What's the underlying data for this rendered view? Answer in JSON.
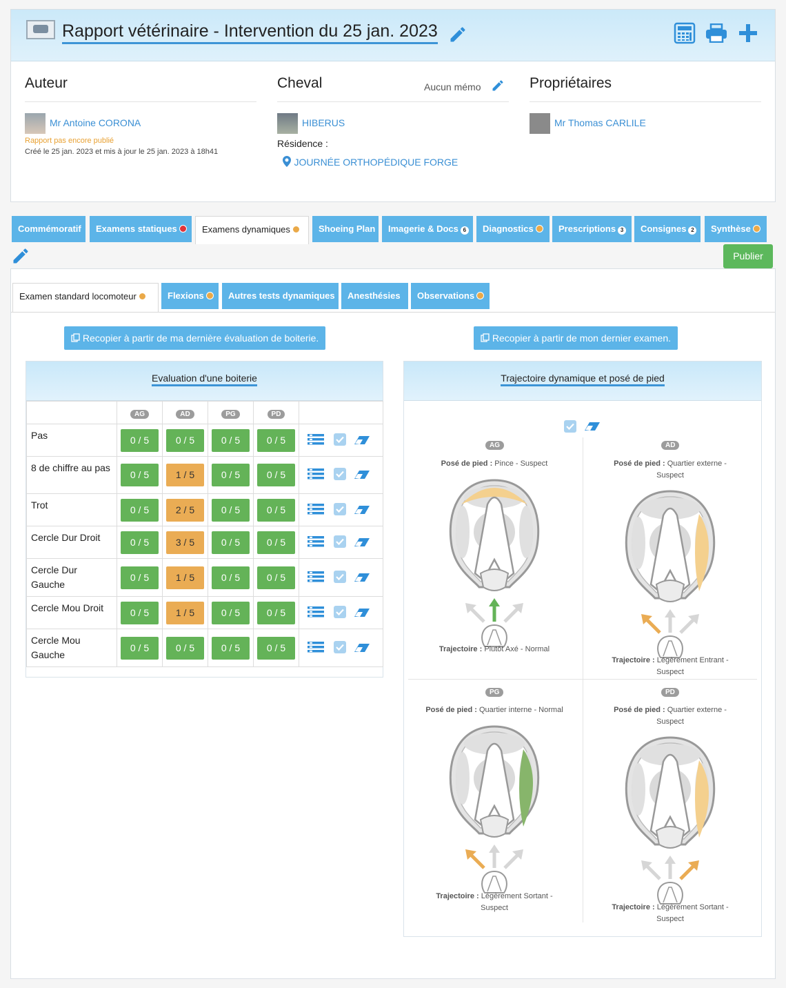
{
  "header": {
    "title": "Rapport vétérinaire - Intervention du 25 jan. 2023"
  },
  "author": {
    "heading": "Auteur",
    "name": "Mr Antoine CORONA",
    "status": "Rapport pas encore publié",
    "dates": "Créé le 25 jan. 2023 et mis à jour le 25 jan. 2023 à 18h41"
  },
  "horse": {
    "heading": "Cheval",
    "memo": "Aucun mémo",
    "name": "HIBERUS",
    "residence_label": "Résidence :",
    "residence": "JOURNÉE ORTHOPÉDIQUE FORGE"
  },
  "owners": {
    "heading": "Propriétaires",
    "name": "Mr Thomas CARLILE"
  },
  "tabs": [
    {
      "label": "Commémoratif"
    },
    {
      "label": "Examens statiques"
    },
    {
      "label": "Examens dynamiques"
    },
    {
      "label": "Shoeing Plan"
    },
    {
      "label": "Imagerie & Docs",
      "count": "6"
    },
    {
      "label": "Diagnostics"
    },
    {
      "label": "Prescriptions",
      "count": "3"
    },
    {
      "label": "Consignes",
      "count": "2"
    },
    {
      "label": "Synthèse"
    }
  ],
  "publish_label": "Publier",
  "subtabs": [
    {
      "label": "Examen standard locomoteur"
    },
    {
      "label": "Flexions"
    },
    {
      "label": "Autres tests dynamiques"
    },
    {
      "label": "Anesthésies"
    },
    {
      "label": "Observations"
    }
  ],
  "copy_buttons": {
    "left": "Recopier à partir de ma dernière évaluation de boiterie.",
    "right": "Recopier à partir de mon dernier examen."
  },
  "lameness": {
    "title": "Evaluation d'une boiterie",
    "columns": [
      "AG",
      "AD",
      "PG",
      "PD"
    ],
    "rows": [
      {
        "label": "Pas",
        "scores": [
          "0 / 5",
          "0 / 5",
          "0 / 5",
          "0 / 5"
        ],
        "levels": [
          "g",
          "g",
          "g",
          "g"
        ]
      },
      {
        "label": "8 de chiffre au pas",
        "scores": [
          "0 / 5",
          "1 / 5",
          "0 / 5",
          "0 / 5"
        ],
        "levels": [
          "g",
          "o",
          "g",
          "g"
        ]
      },
      {
        "label": "Trot",
        "scores": [
          "0 / 5",
          "2 / 5",
          "0 / 5",
          "0 / 5"
        ],
        "levels": [
          "g",
          "o",
          "g",
          "g"
        ]
      },
      {
        "label": "Cercle Dur Droit",
        "scores": [
          "0 / 5",
          "3 / 5",
          "0 / 5",
          "0 / 5"
        ],
        "levels": [
          "g",
          "o",
          "g",
          "g"
        ]
      },
      {
        "label": "Cercle Dur Gauche",
        "scores": [
          "0 / 5",
          "1 / 5",
          "0 / 5",
          "0 / 5"
        ],
        "levels": [
          "g",
          "o",
          "g",
          "g"
        ]
      },
      {
        "label": "Cercle Mou Droit",
        "scores": [
          "0 / 5",
          "1 / 5",
          "0 / 5",
          "0 / 5"
        ],
        "levels": [
          "g",
          "o",
          "g",
          "g"
        ]
      },
      {
        "label": "Cercle Mou Gauche",
        "scores": [
          "0 / 5",
          "0 / 5",
          "0 / 5",
          "0 / 5"
        ],
        "levels": [
          "g",
          "g",
          "g",
          "g"
        ]
      }
    ]
  },
  "trajectory": {
    "title": "Trajectoire dynamique et posé de pied",
    "pose_label": "Posé de pied :",
    "traj_label": "Trajectoire :",
    "legs": [
      {
        "tag": "AG",
        "pose": "Pince - Suspect",
        "traj": "Plutôt Axé - Normal"
      },
      {
        "tag": "AD",
        "pose": "Quartier externe - Suspect",
        "traj": "Légèrement Entrant - Suspect"
      },
      {
        "tag": "PG",
        "pose": "Quartier interne - Normal",
        "traj": "Légèrement Sortant - Suspect"
      },
      {
        "tag": "PD",
        "pose": "Quartier externe - Suspect",
        "traj": "Légèrement Sortant - Suspect"
      }
    ]
  },
  "colors": {
    "accent": "#5cb4e8",
    "score_green": "#64b358",
    "score_orange": "#eaac54",
    "dot_red": "#e0343a",
    "dot_orange": "#eaa948"
  }
}
